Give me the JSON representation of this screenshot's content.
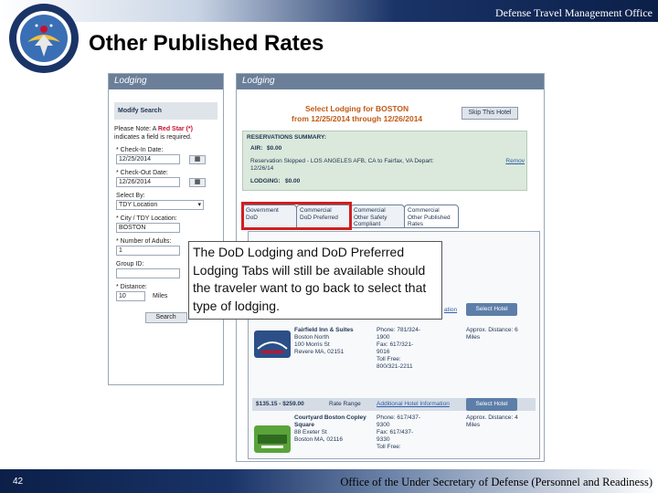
{
  "header": {
    "office": "Defense Travel Management Office",
    "title": "Other Published Rates"
  },
  "left_panel": {
    "heading": "Lodging",
    "modify_search": "Modify Search",
    "note_prefix": "Please Note: A ",
    "note_red": "Red Star (*)",
    "note_suffix": "indicates a field is required.",
    "checkin_label": "* Check-In Date:",
    "checkin_value": "12/25/2014",
    "checkout_label": "* Check-Out Date:",
    "checkout_value": "12/26/2014",
    "select_by_label": "Select By:",
    "select_by_value": "TDY Location",
    "city_label": "* City / TDY Location:",
    "city_value": "BOSTON",
    "adults_label": "* Number of Adults:",
    "adults_value": "1",
    "group_label": "Group ID:",
    "distance_label": "* Distance:",
    "distance_value": "10",
    "distance_unit": "Miles",
    "search_button": "Search"
  },
  "right_panel": {
    "heading": "Lodging",
    "select_title_1": "Select Lodging for BOSTON",
    "select_title_2": "from 12/25/2014 through 12/26/2014",
    "skip_button": "Skip This Hotel",
    "summary_title": "RESERVATIONS SUMMARY:",
    "air_label": "AIR:",
    "air_value": "$0.00",
    "skipped_line_1": "Reservation Skipped - LOS ANGELES AFB, CA to Fairfax, VA Depart:",
    "skipped_line_2": "12/26/14",
    "remove_link": "Remov",
    "lodging_label": "LODGING:",
    "lodging_value": "$0.00",
    "tabs": [
      {
        "line1": "Government",
        "line2": "DoD"
      },
      {
        "line1": "Commercial",
        "line2": "DoD Preferred"
      },
      {
        "line1": "Commercial",
        "line2": "Other Safety",
        "line3": "Compliant"
      },
      {
        "line1": "Commercial",
        "line2": "Other Published",
        "line3": "Rates"
      }
    ],
    "hotel1": {
      "link_partial": "ation",
      "select_label": "Select Hotel",
      "name": "Fairfield Inn & Suites",
      "addr1": "Boston North",
      "addr2": "100 Morris St",
      "addr3": "Revere MA, 02151",
      "phone1": "Phone: 781/324-",
      "phone2": "1900",
      "fax1": "Fax: 617/321-",
      "fax2": "9016",
      "tollfree1": "Toll Free:",
      "tollfree2": "800/321-2211",
      "distance1": "Approx. Distance: 6",
      "distance2": "Miles"
    },
    "hotel2": {
      "rate": "$135.15 - $259.00",
      "rate_range": "Rate Range",
      "info_link": "Additional Hotel Information",
      "select_label": "Select Hotel",
      "name1": "Courtyard Boston Copley",
      "name2": "Square",
      "addr1": "88 Exeter St",
      "addr2": "Boston MA, 02116",
      "phone1": "Phone: 617/437-",
      "phone2": "9300",
      "fax1": "Fax: 617/437-",
      "fax2": "9330",
      "tollfree": "Toll Free:",
      "distance1": "Approx. Distance: 4",
      "distance2": "Miles"
    }
  },
  "callout": {
    "text": "The DoD Lodging and DoD Preferred Lodging Tabs will still be available should the traveler want to go back to select that type of lodging."
  },
  "footer": {
    "slide_number": "42",
    "office": "Office of the Under Secretary of Defense (Personnel and Readiness)"
  },
  "colors": {
    "navy": "#0b1f48",
    "highlight_red": "#cf1f1f",
    "select_button": "#5d7ea8",
    "panel_head": "#6b7f99"
  },
  "icons": {
    "seal": "dod-seal-icon",
    "calendar": "calendar-icon",
    "dropdown": "chevron-down-icon"
  }
}
